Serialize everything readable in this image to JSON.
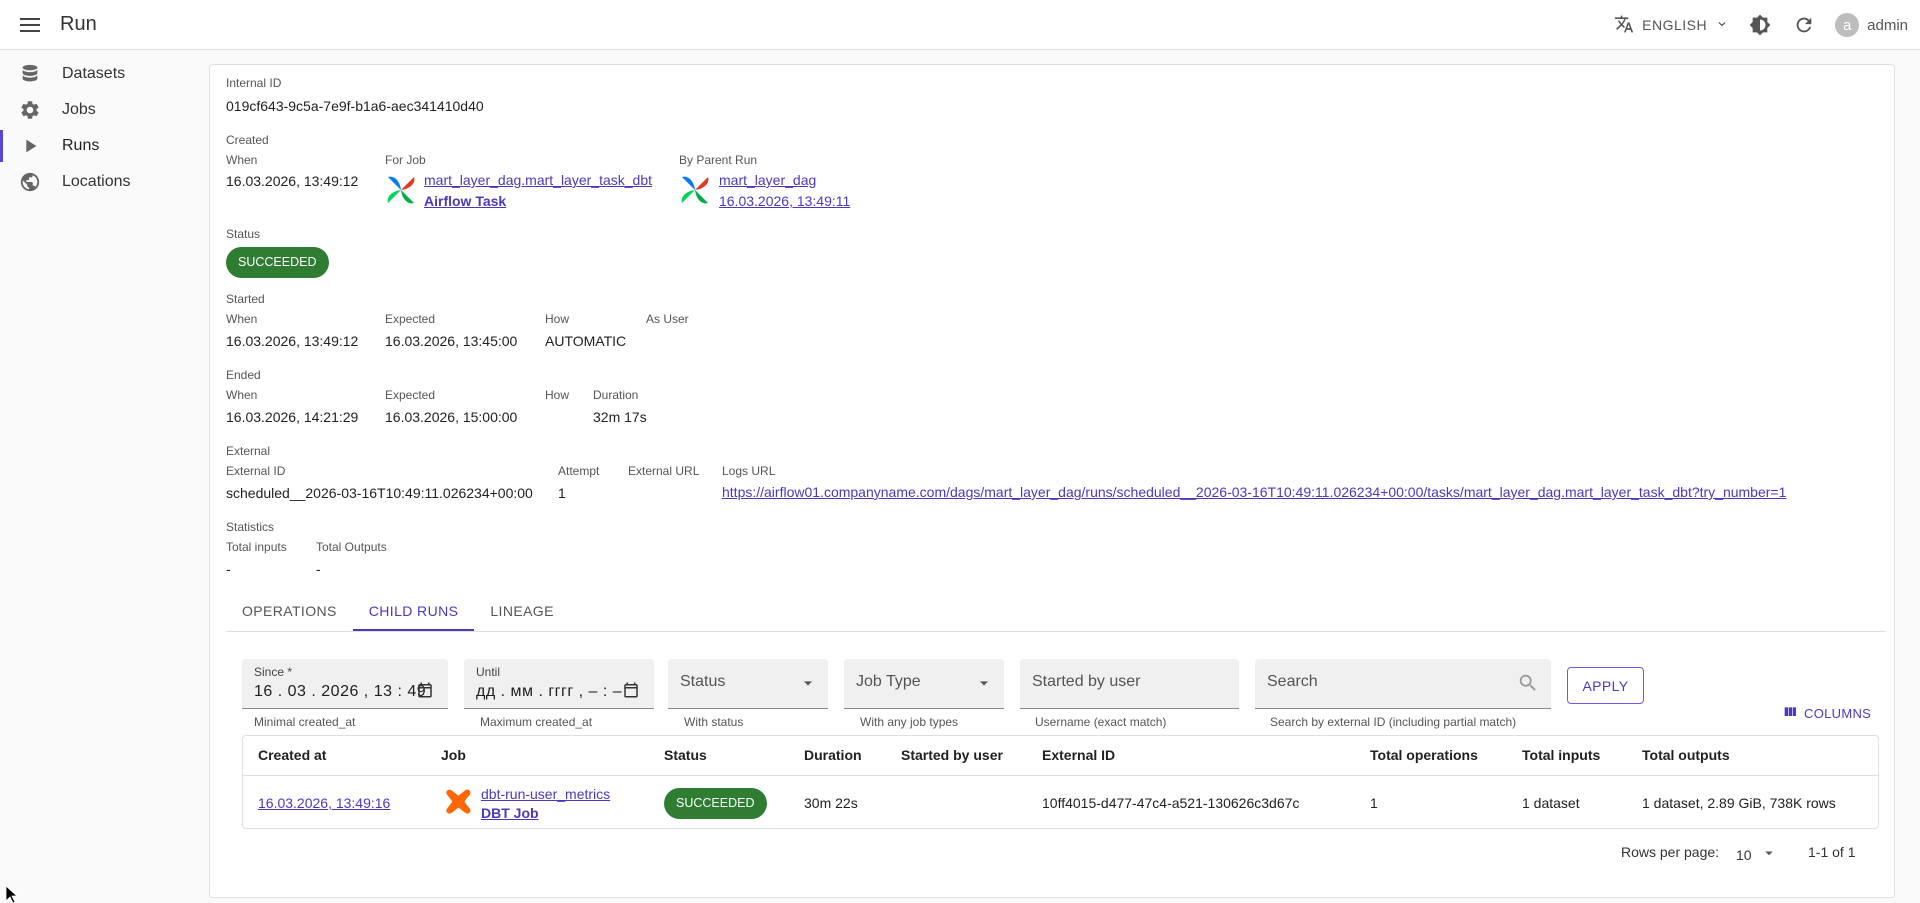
{
  "appbar": {
    "title": "Run",
    "language": "ENGLISH",
    "user": "admin",
    "avatar_letter": "a"
  },
  "sidebar": {
    "items": [
      {
        "label": "Datasets",
        "icon": "database-icon"
      },
      {
        "label": "Jobs",
        "icon": "gear-icon"
      },
      {
        "label": "Runs",
        "icon": "play-icon"
      },
      {
        "label": "Locations",
        "icon": "globe-icon"
      }
    ],
    "active": "Runs"
  },
  "run": {
    "internal_id_label": "Internal ID",
    "internal_id": "019cf643-9c5a-7e9f-b1a6-aec341410d40",
    "created": {
      "label": "Created",
      "when_label": "When",
      "when": "16.03.2026, 13:49:12",
      "for_job_label": "For Job",
      "job_name": "mart_layer_dag.mart_layer_task_dbt",
      "job_type": "Airflow Task",
      "parent_label": "By Parent Run",
      "parent_name": "mart_layer_dag",
      "parent_time": "16.03.2026, 13:49:11"
    },
    "status_label": "Status",
    "status": "SUCCEEDED",
    "started": {
      "label": "Started",
      "when_label": "When",
      "when": "16.03.2026, 13:49:12",
      "expected_label": "Expected",
      "expected": "16.03.2026, 13:45:00",
      "how_label": "How",
      "how": "AUTOMATIC",
      "as_user_label": "As User"
    },
    "ended": {
      "label": "Ended",
      "when_label": "When",
      "when": "16.03.2026, 14:21:29",
      "expected_label": "Expected",
      "expected": "16.03.2026, 15:00:00",
      "how_label": "How",
      "duration_label": "Duration",
      "duration": "32m 17s"
    },
    "external": {
      "label": "External",
      "external_id_label": "External ID",
      "external_id": "scheduled__2026-03-16T10:49:11.026234+00:00",
      "attempt_label": "Attempt",
      "attempt": "1",
      "external_url_label": "External URL",
      "logs_url_label": "Logs URL",
      "logs_url": "https://airflow01.companyname.com/dags/mart_layer_dag/runs/scheduled__2026-03-16T10:49:11.026234+00:00/tasks/mart_layer_dag.mart_layer_task_dbt?try_number=1"
    },
    "statistics": {
      "label": "Statistics",
      "total_inputs_label": "Total inputs",
      "total_inputs": "-",
      "total_outputs_label": "Total Outputs",
      "total_outputs": "-"
    }
  },
  "tabs": [
    "OPERATIONS",
    "CHILD RUNS",
    "LINEAGE"
  ],
  "active_tab": "CHILD RUNS",
  "filters": {
    "since": {
      "label": "Since *",
      "value": "16 . 03 . 2026 ,  13 : 49",
      "helper": "Minimal created_at"
    },
    "until": {
      "label": "Until",
      "value": "дд . мм . гггг ,  – : –",
      "helper": "Maximum created_at"
    },
    "status": {
      "placeholder": "Status",
      "helper": "With status"
    },
    "job_type": {
      "placeholder": "Job Type",
      "helper": "With any job types"
    },
    "started_by": {
      "placeholder": "Started by user",
      "helper": "Username (exact match)"
    },
    "search": {
      "placeholder": "Search",
      "helper": "Search by external ID (including partial match)"
    },
    "apply_label": "APPLY",
    "columns_label": "COLUMNS"
  },
  "table": {
    "headers": [
      "Created at",
      "Job",
      "Status",
      "Duration",
      "Started by user",
      "External ID",
      "Total operations",
      "Total inputs",
      "Total outputs"
    ],
    "rows": [
      {
        "created_at": "16.03.2026, 13:49:16",
        "job_name": "dbt-run-user_metrics",
        "job_type": "DBT Job",
        "status": "SUCCEEDED",
        "duration": "30m 22s",
        "started_by": "",
        "external_id": "10ff4015-d477-47c4-a521-130626c3d67c",
        "total_operations": "1",
        "total_inputs": "1 dataset",
        "total_outputs": "1 dataset, 2.89 GiB, 738K rows"
      }
    ]
  },
  "pagination": {
    "rows_per_page_label": "Rows per page:",
    "rows_per_page": "10",
    "range": "1-1 of 1"
  },
  "colors": {
    "accent": "#4a3aba",
    "success": "#2e7d32"
  }
}
